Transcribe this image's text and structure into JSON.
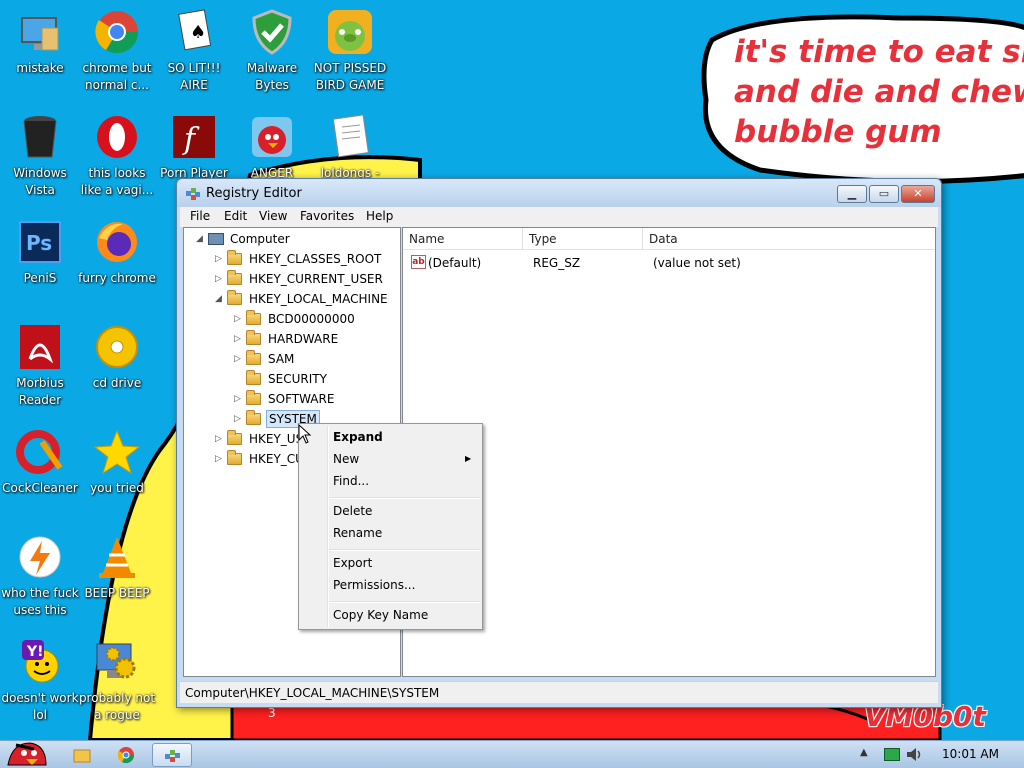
{
  "desktop": {
    "icons": [
      {
        "label": "mistake",
        "icon": "monitor-icon"
      },
      {
        "label": "chrome but normal c...",
        "icon": "chrome-icon"
      },
      {
        "label": "SO LIT!!! AIRE",
        "icon": "solitaire-icon"
      },
      {
        "label": "Malware Bytes",
        "icon": "shield-icon"
      },
      {
        "label": "NOT PISSED BIRD GAME",
        "icon": "pig-icon"
      },
      {
        "label": "Windows Vista",
        "icon": "trash-icon"
      },
      {
        "label": "this looks like a vagi...",
        "icon": "opera-icon"
      },
      {
        "label": "Porn Player",
        "icon": "flash-icon"
      },
      {
        "label": "ANGER",
        "icon": "angry-bird-icon"
      },
      {
        "label": "loldongs -",
        "icon": "document-icon"
      },
      {
        "label": "PeniS",
        "icon": "photoshop-icon"
      },
      {
        "label": "furry chrome",
        "icon": "firefox-icon"
      },
      {
        "label": "Morbius Reader",
        "icon": "acrobat-icon"
      },
      {
        "label": "cd drive",
        "icon": "cd-icon"
      },
      {
        "label": "CockCleaner",
        "icon": "ccleaner-icon"
      },
      {
        "label": "you tried",
        "icon": "star-icon"
      },
      {
        "label": "who the fuck uses this",
        "icon": "avast-icon"
      },
      {
        "label": "BEEP BEEP",
        "icon": "vlc-icon"
      },
      {
        "label": "doesn't work lol",
        "icon": "yahoo-icon"
      },
      {
        "label": "probably not a rogue",
        "icon": "settings-monitor-icon"
      }
    ],
    "speech": [
      "it's time to eat shit",
      "and die and chew",
      "bubble gum"
    ],
    "signature": "VM0b0t",
    "stray_label": "3"
  },
  "window": {
    "title": "Registry Editor",
    "menu": [
      "File",
      "Edit",
      "View",
      "Favorites",
      "Help"
    ],
    "tree": [
      {
        "label": "Computer",
        "expander": "◢"
      },
      {
        "label": "HKEY_CLASSES_ROOT",
        "expander": "▷"
      },
      {
        "label": "HKEY_CURRENT_USER",
        "expander": "▷"
      },
      {
        "label": "HKEY_LOCAL_MACHINE",
        "expander": "◢"
      },
      {
        "label": "BCD00000000",
        "expander": "▷"
      },
      {
        "label": "HARDWARE",
        "expander": "▷"
      },
      {
        "label": "SAM",
        "expander": "▷"
      },
      {
        "label": "SECURITY",
        "expander": ""
      },
      {
        "label": "SOFTWARE",
        "expander": "▷"
      },
      {
        "label": "SYSTEM",
        "expander": "▷"
      },
      {
        "label": "HKEY_USERS",
        "expander": "▷"
      },
      {
        "label": "HKEY_CURRENT_CONFIG",
        "expander": "▷"
      }
    ],
    "columns": [
      "Name",
      "Type",
      "Data"
    ],
    "values": [
      {
        "name": "(Default)",
        "type": "REG_SZ",
        "data": "(value not set)"
      }
    ],
    "status": "Computer\\HKEY_LOCAL_MACHINE\\SYSTEM"
  },
  "context_menu": {
    "items": [
      "Expand",
      "New",
      "Find...",
      "Delete",
      "Rename",
      "Export",
      "Permissions...",
      "Copy Key Name"
    ]
  },
  "taskbar": {
    "clock": "10:01 AM"
  },
  "colors": {
    "wallpaper": "#0aa9e6",
    "speech_text": "#e8303a"
  }
}
